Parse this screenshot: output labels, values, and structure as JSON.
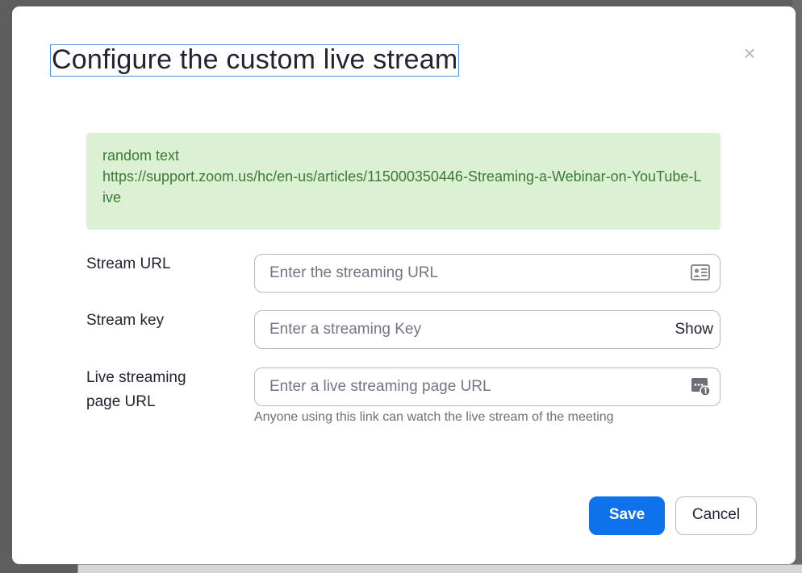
{
  "dialog": {
    "title": "Configure the custom live stream",
    "close_label": "×"
  },
  "info": {
    "line1": "random text",
    "line2": "https://support.zoom.us/hc/en-us/articles/115000350446-Streaming-a-Webinar-on-YouTube-Live"
  },
  "fields": {
    "stream_url": {
      "label": "Stream URL",
      "value": "",
      "placeholder": "Enter the streaming URL",
      "icon": "contact-card-icon"
    },
    "stream_key": {
      "label": "Stream key",
      "value": "",
      "placeholder": "Enter a streaming Key",
      "toggle_label": "Show"
    },
    "page_url": {
      "label_line1": "Live streaming",
      "label_line2": "page URL",
      "value": "",
      "placeholder": "Enter a live streaming page URL",
      "icon": "password-manager-icon",
      "hint": "Anyone using this link can watch the live stream of the meeting"
    }
  },
  "buttons": {
    "save_label": "Save",
    "cancel_label": "Cancel"
  },
  "colors": {
    "primary": "#0e72ed",
    "info_background": "#dcf0d4",
    "info_text": "#3c7a37",
    "title_focus_outline": "#4a90e2"
  }
}
